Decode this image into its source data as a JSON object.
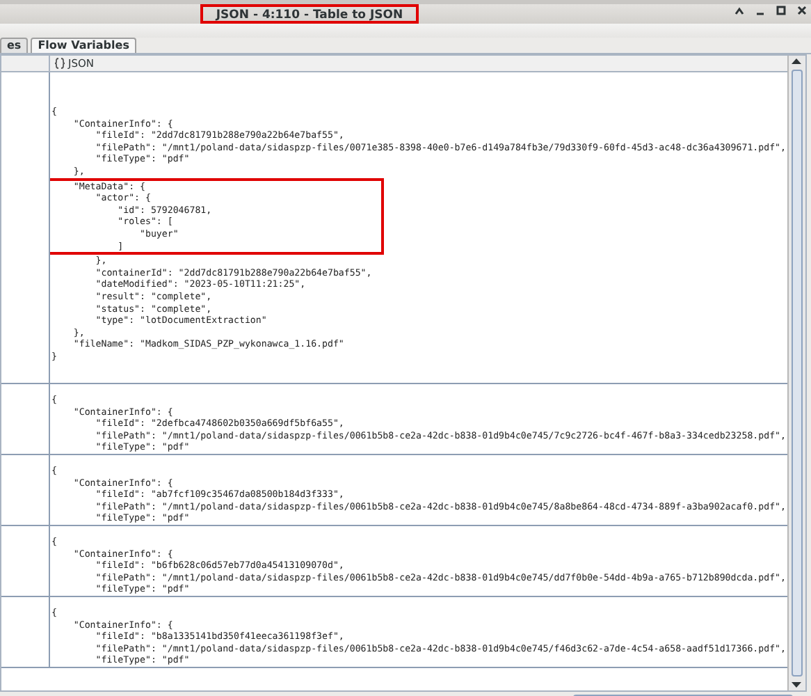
{
  "window": {
    "title": "JSON - 4:110 - Table to JSON",
    "highlighted": true
  },
  "tabs": [
    {
      "label": "es",
      "selected": false
    },
    {
      "label": "Flow Variables",
      "selected": true
    }
  ],
  "table": {
    "columns": [
      {
        "label": "JSON"
      }
    ],
    "rows": [
      {
        "lines": [
          {
            "text": "{",
            "highlighted": false
          },
          {
            "text": "    \"ContainerInfo\": {",
            "highlighted": false
          },
          {
            "text": "        \"fileId\": \"2dd7dc81791b288e790a22b64e7baf55\",",
            "highlighted": false
          },
          {
            "text": "        \"filePath\": \"/mnt1/poland-data/sidaspzp-files/0071e385-8398-40e0-b7e6-d149a784fb3e/79d330f9-60fd-45d3-ac48-dc36a4309671.pdf\",",
            "highlighted": false
          },
          {
            "text": "        \"fileType\": \"pdf\"",
            "highlighted": false
          },
          {
            "text": "    },",
            "highlighted": false
          },
          {
            "text": "    \"MetaData\": {",
            "highlighted": true
          },
          {
            "text": "        \"actor\": {",
            "highlighted": true
          },
          {
            "text": "            \"id\": 5792046781,",
            "highlighted": true
          },
          {
            "text": "            \"roles\": [",
            "highlighted": true
          },
          {
            "text": "                \"buyer\"",
            "highlighted": true
          },
          {
            "text": "            ]",
            "highlighted": true
          },
          {
            "text": "        },",
            "highlighted": false
          },
          {
            "text": "        \"containerId\": \"2dd7dc81791b288e790a22b64e7baf55\",",
            "highlighted": false
          },
          {
            "text": "        \"dateModified\": \"2023-05-10T11:21:25\",",
            "highlighted": false
          },
          {
            "text": "        \"result\": \"complete\",",
            "highlighted": false
          },
          {
            "text": "        \"status\": \"complete\",",
            "highlighted": false
          },
          {
            "text": "        \"type\": \"lotDocumentExtraction\"",
            "highlighted": false
          },
          {
            "text": "    },",
            "highlighted": false
          },
          {
            "text": "    \"fileName\": \"Madkom_SIDAS_PZP_wykonawca_1.16.pdf\"",
            "highlighted": false
          },
          {
            "text": "}",
            "highlighted": false
          }
        ]
      },
      {
        "lines": [
          {
            "text": "{",
            "highlighted": false
          },
          {
            "text": "    \"ContainerInfo\": {",
            "highlighted": false
          },
          {
            "text": "        \"fileId\": \"2defbca4748602b0350a669df5bf6a55\",",
            "highlighted": false
          },
          {
            "text": "        \"filePath\": \"/mnt1/poland-data/sidaspzp-files/0061b5b8-ce2a-42dc-b838-01d9b4c0e745/7c9c2726-bc4f-467f-b8a3-334cedb23258.pdf\",",
            "highlighted": false
          },
          {
            "text": "        \"fileType\": \"pdf\"",
            "highlighted": false
          }
        ]
      },
      {
        "lines": [
          {
            "text": "{",
            "highlighted": false
          },
          {
            "text": "    \"ContainerInfo\": {",
            "highlighted": false
          },
          {
            "text": "        \"fileId\": \"ab7fcf109c35467da08500b184d3f333\",",
            "highlighted": false
          },
          {
            "text": "        \"filePath\": \"/mnt1/poland-data/sidaspzp-files/0061b5b8-ce2a-42dc-b838-01d9b4c0e745/8a8be864-48cd-4734-889f-a3ba902acaf0.pdf\",",
            "highlighted": false
          },
          {
            "text": "        \"fileType\": \"pdf\"",
            "highlighted": false
          }
        ]
      },
      {
        "lines": [
          {
            "text": "{",
            "highlighted": false
          },
          {
            "text": "    \"ContainerInfo\": {",
            "highlighted": false
          },
          {
            "text": "        \"fileId\": \"b6fb628c06d57eb77d0a45413109070d\",",
            "highlighted": false
          },
          {
            "text": "        \"filePath\": \"/mnt1/poland-data/sidaspzp-files/0061b5b8-ce2a-42dc-b838-01d9b4c0e745/dd7f0b0e-54dd-4b9a-a765-b712b890dcda.pdf\",",
            "highlighted": false
          },
          {
            "text": "        \"fileType\": \"pdf\"",
            "highlighted": false
          }
        ]
      },
      {
        "lines": [
          {
            "text": "{",
            "highlighted": false
          },
          {
            "text": "    \"ContainerInfo\": {",
            "highlighted": false
          },
          {
            "text": "        \"fileId\": \"b8a1335141bd350f41eeca361198f3ef\",",
            "highlighted": false
          },
          {
            "text": "        \"filePath\": \"/mnt1/poland-data/sidaspzp-files/0061b5b8-ce2a-42dc-b838-01d9b4c0e745/f46d3c62-a7de-4c54-a658-aadf51d17366.pdf\",",
            "highlighted": false
          },
          {
            "text": "        \"fileType\": \"pdf\"",
            "highlighted": false
          }
        ]
      }
    ]
  }
}
